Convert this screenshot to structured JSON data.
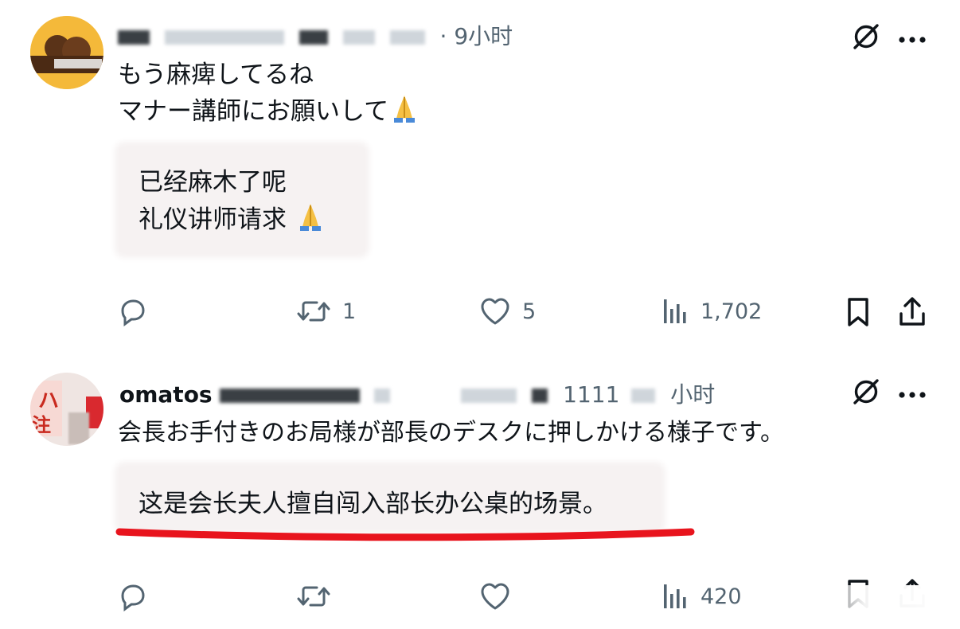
{
  "posts": [
    {
      "time": "9小时",
      "jp_lines": [
        "もう麻痺してるね",
        "マナー講師にお願いして"
      ],
      "translation_lines": [
        "已经麻木了呢",
        "礼仪讲师请求"
      ],
      "actions": {
        "reply": "",
        "repost": "1",
        "like": "5",
        "views": "1,702"
      }
    },
    {
      "name_fragment": "omatos",
      "handle_fragment": "1111",
      "time": "小时",
      "jp_lines": [
        "会長お手付きのお局様が部長のデスクに押しかける様子です。"
      ],
      "translation_lines": [
        "这是会长夫人擅自闯入部长办公桌的场景。"
      ],
      "actions": {
        "reply": "",
        "repost": "",
        "like": "",
        "views": "420"
      }
    }
  ],
  "icons": [
    "reply-icon",
    "repost-icon",
    "like-icon",
    "views-icon",
    "bookmark-icon",
    "share-icon",
    "grok-icon",
    "more-icon"
  ],
  "colors": {
    "text": "#0f1419",
    "muted": "#536471",
    "highlight": "#e8141d",
    "translation_bg": "#f6f2f2"
  }
}
